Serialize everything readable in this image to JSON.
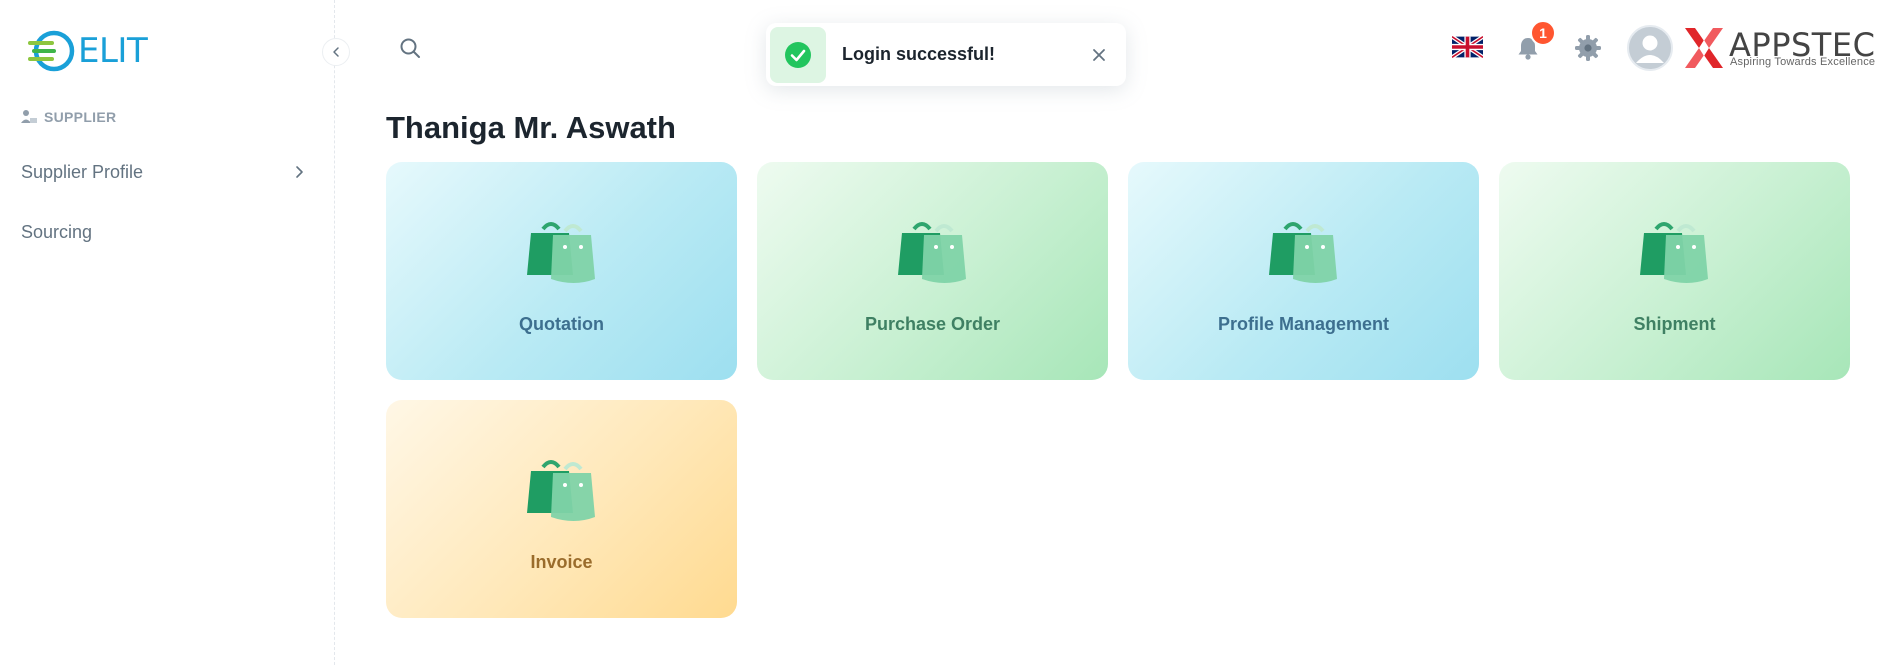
{
  "app": {
    "logo_text": "ELIT",
    "brand_name": "APPSTEC",
    "brand_tagline": "Aspiring Towards Excellence"
  },
  "sidebar": {
    "section_label": "SUPPLIER",
    "items": [
      {
        "label": "Supplier Profile",
        "has_children": true
      },
      {
        "label": "Sourcing",
        "has_children": false
      }
    ]
  },
  "header": {
    "notification_count": "1",
    "language": "en-GB flag"
  },
  "toast": {
    "message": "Login successful!",
    "type": "success"
  },
  "main": {
    "title": "Thaniga Mr. Aswath",
    "cards": [
      {
        "label": "Quotation",
        "theme": "blue"
      },
      {
        "label": "Purchase Order",
        "theme": "green"
      },
      {
        "label": "Profile Management",
        "theme": "blue"
      },
      {
        "label": "Shipment",
        "theme": "green"
      },
      {
        "label": "Invoice",
        "theme": "yellow"
      }
    ]
  },
  "colors": {
    "accent_blue": "#1aa0d8",
    "accent_green": "#22c55e",
    "badge_red": "#ff5630",
    "text_primary": "#1c252e",
    "text_secondary": "#637381"
  }
}
